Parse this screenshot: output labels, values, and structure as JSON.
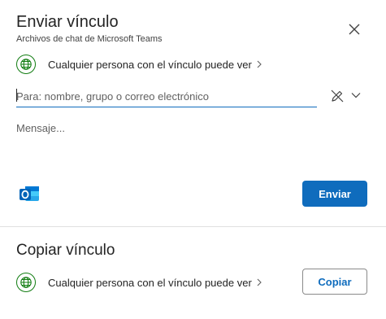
{
  "dialog": {
    "title": "Enviar vínculo",
    "subtitle": "Archivos de chat de Microsoft Teams",
    "close_icon": "close-icon"
  },
  "send": {
    "permission_text": "Cualquier persona con el vínculo puede ver",
    "permission_icon": "globe-icon",
    "to_placeholder": "Para: nombre, grupo o correo electrónico",
    "to_value": "",
    "message_placeholder": "Mensaje...",
    "message_value": "",
    "outlook_icon": "outlook-icon",
    "send_label": "Enviar"
  },
  "copy": {
    "title": "Copiar vínculo",
    "permission_text": "Cualquier persona con el vínculo puede ver",
    "permission_icon": "globe-icon",
    "copy_label": "Copiar"
  },
  "colors": {
    "accent": "#0f6cbd",
    "globe": "#107c10"
  }
}
